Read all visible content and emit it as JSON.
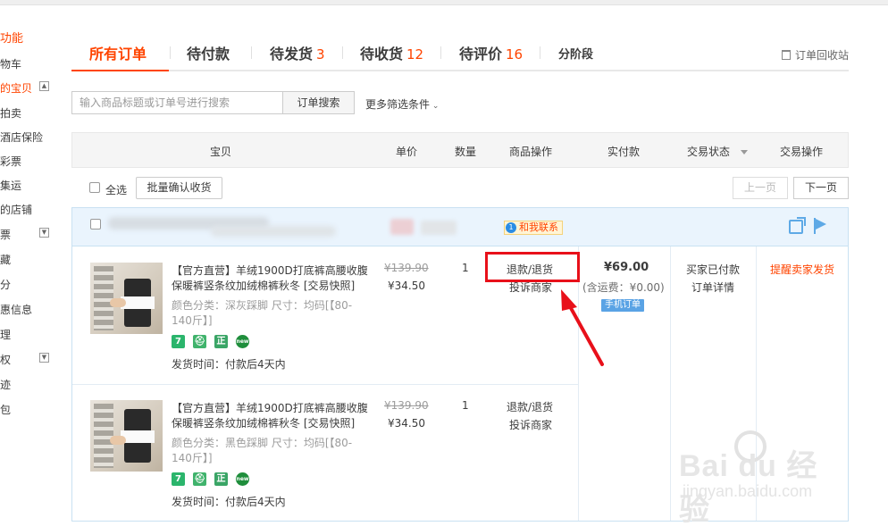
{
  "sidebar": {
    "items": [
      {
        "label": "功能",
        "color": "#ff4400"
      },
      {
        "label": "物车"
      },
      {
        "label": "的宝贝",
        "color": "#ff4400",
        "toggle": "▲"
      },
      {
        "label": "拍卖"
      },
      {
        "label": "酒店保险"
      },
      {
        "label": "彩票"
      },
      {
        "label": "集运"
      },
      {
        "label": "的店铺"
      },
      {
        "label": "票",
        "toggle": "▼"
      },
      {
        "label": "藏"
      },
      {
        "label": "分"
      },
      {
        "label": "惠信息"
      },
      {
        "label": "理"
      },
      {
        "label": "权",
        "toggle": "▼"
      },
      {
        "label": "迹"
      },
      {
        "label": "包"
      }
    ]
  },
  "tabs": {
    "all": "所有订单",
    "unpaid": "待付款",
    "to_ship": "待发货",
    "to_ship_count": "3",
    "to_receive": "待收货",
    "to_receive_count": "12",
    "to_review": "待评价",
    "to_review_count": "16",
    "stage": "分阶段",
    "recycle": "订单回收站"
  },
  "search": {
    "placeholder": "输入商品标题或订单号进行搜索",
    "button": "订单搜索",
    "more_filters": "更多筛选条件"
  },
  "table_header": {
    "item": "宝贝",
    "unit_price": "单价",
    "quantity": "数量",
    "item_ops": "商品操作",
    "paid": "实付款",
    "status": "交易状态",
    "actions": "交易操作"
  },
  "toolbar": {
    "select_all": "全选",
    "batch_confirm": "批量确认收货",
    "prev": "上一页",
    "next": "下一页"
  },
  "order": {
    "contact": "和我联系",
    "contact_badge": "1",
    "items": [
      {
        "title": "【官方直营】羊绒1900D打底裤高腰收腹保暖裤竖条纹加绒棉裤秋冬 [交易快照]",
        "sku": "颜色分类：深灰踩脚   尺寸：均码[【80-140斤】]",
        "ship_time": "发货时间：付款后4天内",
        "price_old": "¥139.90",
        "price_new": "¥34.50",
        "qty": "1",
        "op1": "退款/退货",
        "op2": "投诉商家"
      },
      {
        "title": "【官方直营】羊绒1900D打底裤高腰收腹保暖裤竖条纹加绒棉裤秋冬 [交易快照]",
        "sku": "颜色分类：黑色踩脚   尺寸：均码[【80-140斤】]",
        "ship_time": "发货时间：付款后4天内",
        "price_old": "¥139.90",
        "price_new": "¥34.50",
        "qty": "1",
        "op1": "退款/退货",
        "op2": "投诉商家"
      }
    ],
    "badges": [
      "7",
      "⛑",
      "正",
      "new"
    ],
    "total": "¥69.00",
    "shipping": "(含运费：¥0.00)",
    "mobile_tag": "手机订单",
    "status": "买家已付款",
    "detail": "订单详情",
    "remind": "提醒卖家发货"
  },
  "watermark": {
    "brand": "Bai du 经验",
    "url": "jingyan.baidu.com"
  },
  "colors": {
    "accent": "#ff4400",
    "highlight_box": "#e8101a",
    "order_border": "#c9e1f2"
  }
}
